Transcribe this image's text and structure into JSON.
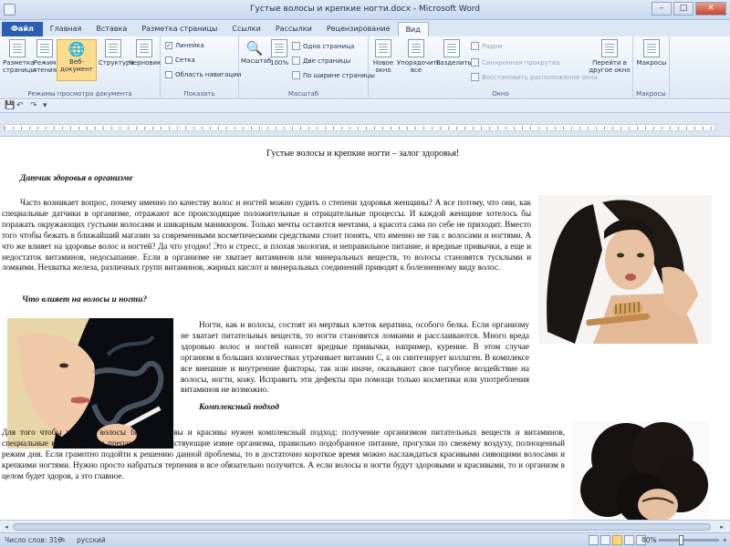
{
  "window": {
    "title": "Густые волосы и крепкие ногти.docx - Microsoft Word",
    "controls": {
      "minimize": "–",
      "maximize": "□",
      "close": "✕"
    }
  },
  "tabs": [
    {
      "label": "Файл"
    },
    {
      "label": "Главная"
    },
    {
      "label": "Вставка"
    },
    {
      "label": "Разметка страницы"
    },
    {
      "label": "Ссылки"
    },
    {
      "label": "Рассылки"
    },
    {
      "label": "Рецензирование"
    },
    {
      "label": "Вид"
    }
  ],
  "ribbon": {
    "views": {
      "buttons": [
        {
          "label": "Разметка страницы"
        },
        {
          "label": "Режим чтения"
        },
        {
          "label": "Веб-документ"
        },
        {
          "label": "Структура"
        },
        {
          "label": "Черновик"
        }
      ],
      "label": "Режимы просмотра документа"
    },
    "show": {
      "items": [
        {
          "label": "Линейка",
          "checked": true
        },
        {
          "label": "Сетка",
          "checked": false
        },
        {
          "label": "Область навигации",
          "checked": false
        }
      ],
      "label": "Показать"
    },
    "zoom": {
      "zoom_btn": "Масштаб",
      "hundred_btn": "100%",
      "one_page": "Одна страница",
      "two_pages": "Две страницы",
      "page_width": "По ширине страницы",
      "label": "Масштаб"
    },
    "window": {
      "new_window": "Новое окно",
      "arrange_all": "Упорядочить все",
      "split": "Разделить",
      "side_by_side": "Рядом",
      "sync_scroll": "Синхронная прокрутка",
      "reset_pos": "Восстановить расположение окна",
      "switch_windows": "Перейти в другое окно",
      "label": "Окно"
    },
    "macros": {
      "button": "Макросы",
      "label": "Макросы"
    }
  },
  "document": {
    "title": "Густые волосы и крепкие ногти – залог  здоровья!",
    "h1": "Датчик здоровья в организме",
    "p1": "Часто возникает вопрос, почему именно  по качеству волос и ногтей можно судить о степени здоровья женщины? А все потому, что они, как специальные датчики в организме, отражают все происходящие положительные и отрицательные процессы.  И каждой женщине хотелось бы поражать окружающих густыми волосами и шикарным маникюром. Только мечты остаются мечтами, а красота сама по себе не приходит.  Вместо того    чтобы  бежать в ближайший магазин  за современными косметическими средствами  стоит понять, что именно не так  с волосами и ногтями. А что же  влияет на здоровье волос и ногтей? Да что угодно! Это и стресс, и плохая экология,  и неправильное питание, и вредные привычки,  а еще и недостаток витаминов, недосыпание.  Если в организме не хватает витаминов или минеральных веществ, то волосы становятся тусклыми и ломкими.  Нехватка железа,  различных групп витаминов,  жирных кислот и минеральных соединений  приводят к болезненному виду волос.",
    "h2": "Что влияет на волосы и ногти?",
    "p2a": "Ногти, как и волосы, состоят из мертвых клеток кератина, особого белка.  Если организму не хватает питательных веществ, то ногти становятся ломкими и расслаиваются.   Много вреда здоровью волос и ногтей наносят вредные привычки, например, курение.  В этом случае организм в больших количествах утрачивает витамин  С, а он синтезирует коллаген. В комплексе все внешние и внутренние факторы, так или иначе, оказывают свое пагубное воздействие на волосы, ногти, кожу.   Исправить эти дефекты  при помощи только косметики или   употребления витаминов   не возможно.",
    "h3": "Комплексный подход",
    "p3": "Для того чтобы  ногти и волосы были здоровы и красивы  нужен комплексный подход: получение организмом питательных веществ и витаминов, специальные косметические препараты,  воздействующие извне организма, правильно подобранное питание, прогулки по свежему воздуху, полноценный режим дня.  Если грамотно  подойти к решению данной проблемы, то в достаточно короткое время можно наслаждаться красивыми сияющими волосами и крепкими ногтями. Нужно просто набраться терпения и все обязательно получится. А если волосы и ногти будут здоровыми и красивыми, то и организм в целом будет здоров, а это главное."
  },
  "status": {
    "words": "Число слов: 316",
    "language": "русский",
    "zoom": "80%",
    "zoom_minus": "–",
    "zoom_plus": "+"
  },
  "qat": {
    "save": "💾",
    "undo": "↶",
    "redo": "↷",
    "more": "▾"
  }
}
